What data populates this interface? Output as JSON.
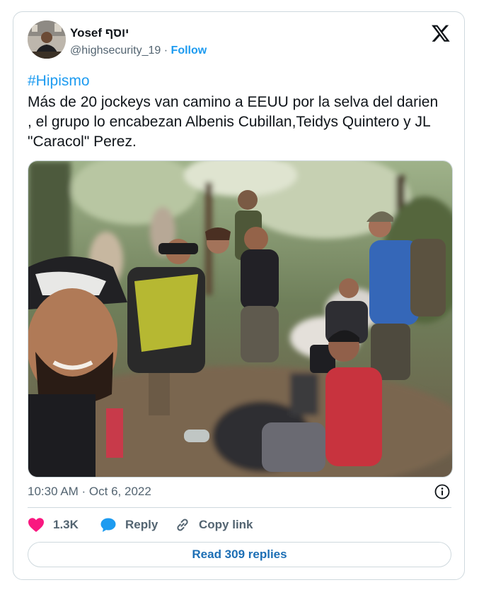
{
  "author": {
    "display_name": "Yosef יוסף",
    "handle": "@highsecurity_19",
    "separator": "·",
    "follow_label": "Follow"
  },
  "tweet": {
    "hashtag": "#Hipismo",
    "text": "Más de 20 jockeys van camino a EEUU por la selva del darien , el grupo lo encabezan Albenis Cubillan,Teidys Quintero y JL \"Caracol\" Perez.",
    "timestamp": "10:30 AM · Oct 6, 2022"
  },
  "actions": {
    "like_count": "1.3K",
    "reply_label": "Reply",
    "copy_link_label": "Copy link"
  },
  "read_replies_label": "Read 309 replies",
  "colors": {
    "link_blue": "#1d9bf0",
    "like_pink": "#f91880",
    "muted_gray": "#536471",
    "border": "#cfd9de"
  },
  "icons": [
    "x-logo-icon",
    "info-icon",
    "heart-icon",
    "reply-bubble-icon",
    "link-icon"
  ]
}
